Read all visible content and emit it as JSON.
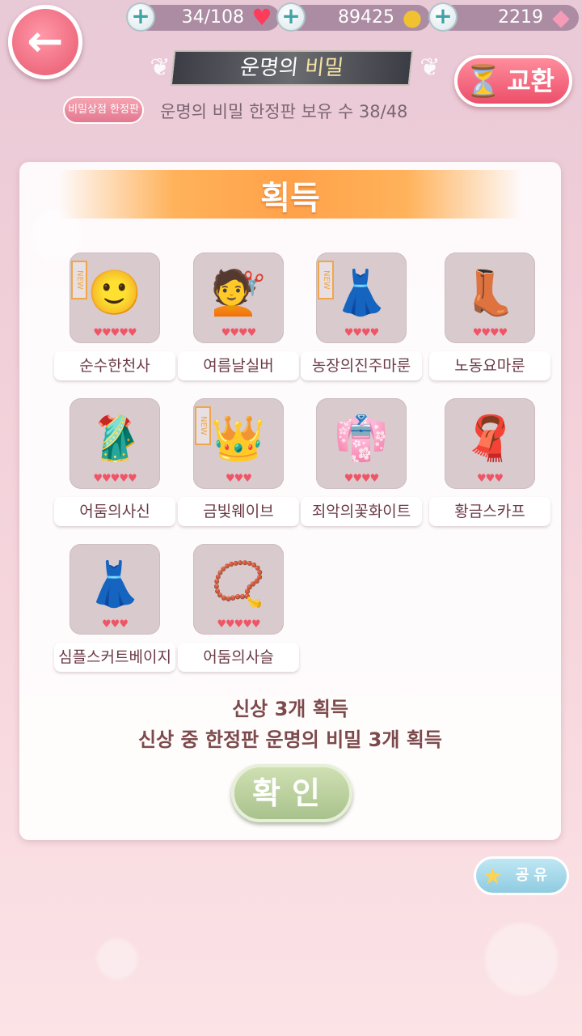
{
  "topbar": {
    "hearts": "34/108",
    "coins": "89425",
    "gems": "2219",
    "plus_icon": "plus-icon",
    "heart_icon": "heart-icon",
    "coin_icon": "coin-icon",
    "gem_icon": "diamond-icon"
  },
  "header": {
    "title_main": "운명의 ",
    "title_hl": "비밀",
    "exchange_label": "교환",
    "limited_badge": "비밀상점 한정판",
    "owned_text": "운명의 비밀 한정판 보유 수 38/48"
  },
  "panel": {
    "title": "획득",
    "items": [
      {
        "label": "순수한천사",
        "hearts": "♥♥♥♥♥",
        "is_new": true,
        "new_text": "NEW",
        "icon": "face-icon",
        "glyph": "🙂"
      },
      {
        "label": "여름날실버",
        "hearts": "♥♥♥♥",
        "is_new": false,
        "icon": "hair-icon",
        "glyph": "💇"
      },
      {
        "label": "농장의진주마룬",
        "hearts": "♥♥♥♥",
        "is_new": true,
        "new_text": "NEW",
        "icon": "dress-icon",
        "glyph": "👗"
      },
      {
        "label": "노동요마룬",
        "hearts": "♥♥♥♥",
        "is_new": false,
        "icon": "boots-icon",
        "glyph": "👢"
      },
      {
        "label": "어둠의사신",
        "hearts": "♥♥♥♥♥",
        "is_new": false,
        "icon": "gown-icon",
        "glyph": "🥻"
      },
      {
        "label": "금빛웨이브",
        "hearts": "♥♥♥",
        "is_new": true,
        "new_text": "NEW",
        "icon": "tiara-icon",
        "glyph": "👑"
      },
      {
        "label": "죄악의꽃화이트",
        "hearts": "♥♥♥♥",
        "is_new": false,
        "icon": "floral-dress-icon",
        "glyph": "👘"
      },
      {
        "label": "황금스카프",
        "hearts": "♥♥♥",
        "is_new": false,
        "icon": "scarf-icon",
        "glyph": "🧣"
      },
      {
        "label": "심플스커트베이지",
        "hearts": "♥♥♥",
        "is_new": false,
        "icon": "skirt-dress-icon",
        "glyph": "👗"
      },
      {
        "label": "어둠의사슬",
        "hearts": "♥♥♥♥♥",
        "is_new": false,
        "icon": "necklace-icon",
        "glyph": "📿"
      }
    ],
    "summary_line1": "신상 3개 획득",
    "summary_line2": "신상 중 한정판 운명의 비밀 3개 획득",
    "confirm_label": "확인"
  },
  "share": {
    "label": "공유",
    "icon": "star-icon"
  }
}
